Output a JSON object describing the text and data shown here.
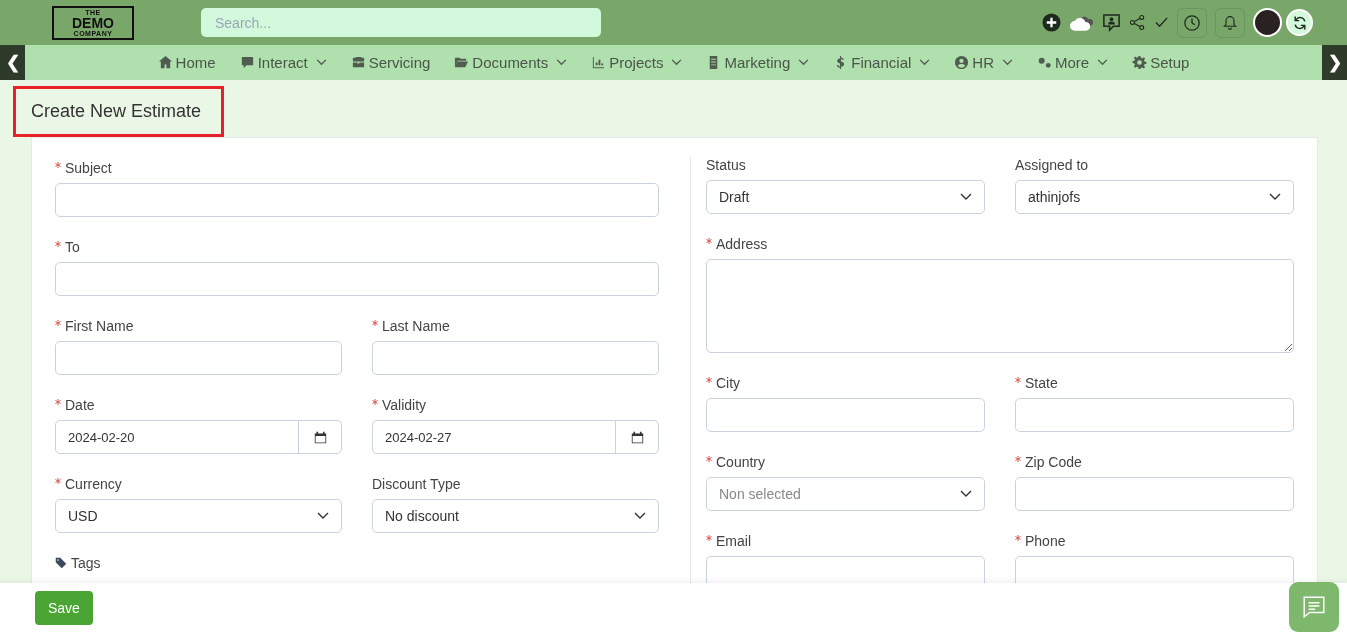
{
  "header": {
    "logo": {
      "top": "THE",
      "main": "DEMO",
      "bottom": "COMPANY"
    },
    "search": {
      "placeholder": "Search..."
    }
  },
  "nav": [
    {
      "label": "Home",
      "dropdown": false
    },
    {
      "label": "Interact",
      "dropdown": true
    },
    {
      "label": "Servicing",
      "dropdown": false
    },
    {
      "label": "Documents",
      "dropdown": true
    },
    {
      "label": "Projects",
      "dropdown": true
    },
    {
      "label": "Marketing",
      "dropdown": true
    },
    {
      "label": "Financial",
      "dropdown": true
    },
    {
      "label": "HR",
      "dropdown": true
    },
    {
      "label": "More",
      "dropdown": true
    },
    {
      "label": "Setup",
      "dropdown": false
    }
  ],
  "nav_arrows": {
    "left": "❮",
    "right": "❯"
  },
  "page_title": "Create New Estimate",
  "left_rows": [
    [
      {
        "label": "Subject",
        "required": true,
        "kind": "text"
      }
    ],
    [
      {
        "label": "To",
        "required": true,
        "kind": "text"
      }
    ],
    [
      {
        "label": "First Name",
        "required": true,
        "kind": "text"
      },
      {
        "label": "Last Name",
        "required": true,
        "kind": "text"
      }
    ],
    [
      {
        "label": "Date",
        "required": true,
        "kind": "date",
        "value": "2024-02-20"
      },
      {
        "label": "Validity",
        "required": true,
        "kind": "date",
        "value": "2024-02-27"
      }
    ],
    [
      {
        "label": "Currency",
        "required": true,
        "kind": "select",
        "value": "USD"
      },
      {
        "label": "Discount Type",
        "required": false,
        "kind": "select",
        "value": "No discount"
      }
    ],
    [
      {
        "label": "Tags",
        "required": false,
        "kind": "tags"
      }
    ]
  ],
  "right_rows": [
    [
      {
        "label": "Status",
        "required": false,
        "kind": "select",
        "value": "Draft"
      },
      {
        "label": "Assigned to",
        "required": false,
        "kind": "select",
        "value": "athinjofs"
      }
    ],
    [
      {
        "label": "Address",
        "required": true,
        "kind": "textarea"
      }
    ],
    [
      {
        "label": "City",
        "required": true,
        "kind": "text"
      },
      {
        "label": "State",
        "required": true,
        "kind": "text"
      }
    ],
    [
      {
        "label": "Country",
        "required": true,
        "kind": "select",
        "placeholder": "Non selected"
      },
      {
        "label": "Zip Code",
        "required": true,
        "kind": "text"
      }
    ],
    [
      {
        "label": "Email",
        "required": true,
        "kind": "text"
      },
      {
        "label": "Phone",
        "required": true,
        "kind": "text"
      }
    ]
  ],
  "footer": {
    "save": "Save"
  }
}
